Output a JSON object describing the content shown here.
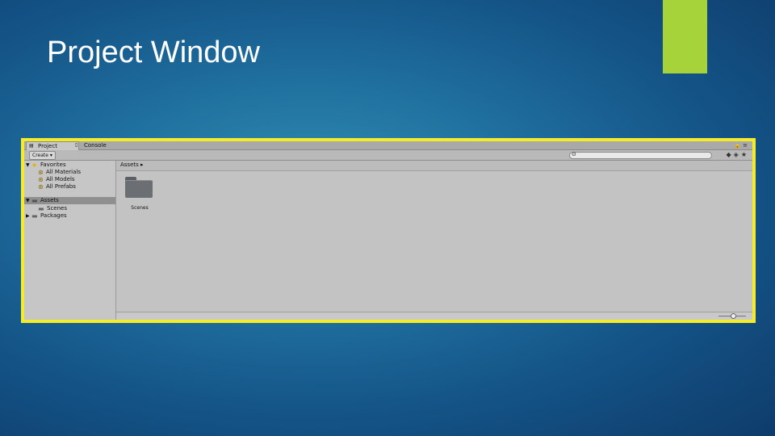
{
  "slide": {
    "title": "Project Window"
  },
  "colors": {
    "highlight_border": "#f4ec2a",
    "accent_bar": "#a6d23a"
  },
  "window": {
    "tabs": [
      {
        "label": "Project",
        "icon": "project-icon",
        "active": true
      },
      {
        "label": "Console",
        "icon": "console-icon",
        "active": false
      }
    ],
    "toolbar": {
      "create_label": "Create ▾"
    },
    "tree": {
      "favorites": {
        "label": "Favorites",
        "items": [
          "All Materials",
          "All Models",
          "All Prefabs"
        ]
      },
      "assets": {
        "label": "Assets",
        "children": [
          "Scenes"
        ]
      },
      "packages": {
        "label": "Packages"
      }
    },
    "breadcrumb": "Assets ▸",
    "content": {
      "folders": [
        {
          "label": "Scenes"
        }
      ]
    }
  }
}
